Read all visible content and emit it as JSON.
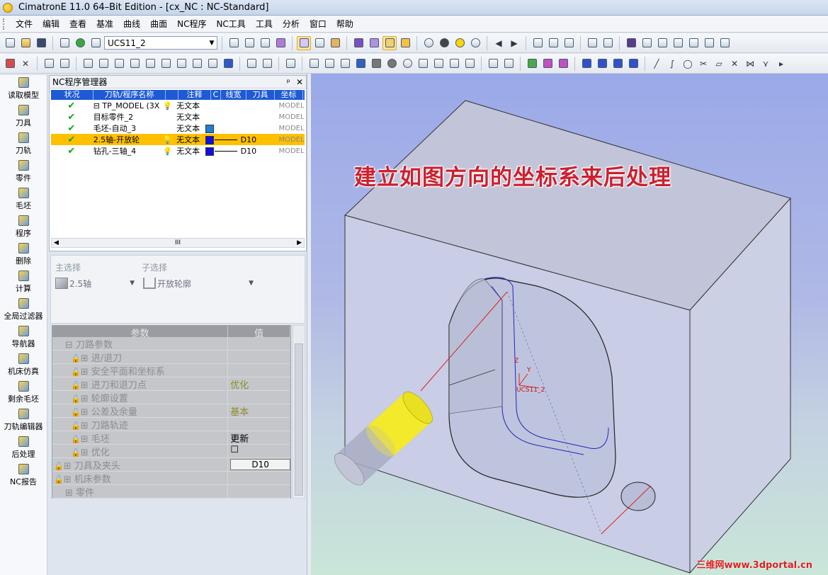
{
  "window": {
    "title": "CimatronE 11.0 64–Bit Edition - [cx_NC : NC-Standard]"
  },
  "menu": [
    "文件",
    "编辑",
    "查看",
    "基准",
    "曲线",
    "曲面",
    "NC程序",
    "NC工具",
    "工具",
    "分析",
    "窗口",
    "帮助"
  ],
  "toolbar": {
    "ucs_value": "UCS11_2"
  },
  "sidebar": [
    {
      "label": "读取模型",
      "icon": "load-model-icon"
    },
    {
      "label": "刀具",
      "icon": "tool-icon"
    },
    {
      "label": "刀轨",
      "icon": "toolpath-icon"
    },
    {
      "label": "零件",
      "icon": "part-icon"
    },
    {
      "label": "毛坯",
      "icon": "stock-icon"
    },
    {
      "label": "程序",
      "icon": "procedure-icon"
    },
    {
      "label": "删除",
      "icon": "delete-icon"
    },
    {
      "label": "计算",
      "icon": "calculate-icon"
    },
    {
      "label": "全局过滤器",
      "icon": "global-filter-icon"
    },
    {
      "label": "导航器",
      "icon": "navigator-icon"
    },
    {
      "label": "机床仿真",
      "icon": "machine-sim-icon"
    },
    {
      "label": "剩余毛坯",
      "icon": "remaining-stock-icon"
    },
    {
      "label": "刀轨编辑器",
      "icon": "toolpath-editor-icon"
    },
    {
      "label": "后处理",
      "icon": "post-process-icon"
    },
    {
      "label": "NC报告",
      "icon": "nc-report-icon"
    }
  ],
  "nc_manager": {
    "title": "NC程序管理器",
    "pin": "ᵖ",
    "close": "✕",
    "columns": [
      "状况",
      "刀轨/程序名称",
      "",
      "注释",
      "C",
      "线宽",
      "刀具",
      "坐标"
    ],
    "rows": [
      {
        "name": "TP_MODEL (3X",
        "comment": "无文本",
        "tool": "",
        "coord": "MODEL",
        "color": "",
        "bulb": true,
        "expand": "⊟"
      },
      {
        "name": "目标零件_2",
        "comment": "无文本",
        "tool": "",
        "coord": "MODEL",
        "color": "",
        "bulb": false,
        "expand": ""
      },
      {
        "name": "毛坯-自动_3",
        "comment": "无文本",
        "tool": "",
        "coord": "MODEL",
        "color": "#1d7fd6",
        "bulb": false,
        "expand": ""
      },
      {
        "name": "2.5轴-开放轮",
        "comment": "无文本",
        "tool": "D10",
        "coord": "MODEL",
        "color": "#1010e0",
        "bulb": true,
        "expand": "",
        "selected": true
      },
      {
        "name": "钻孔-三轴_4",
        "comment": "无文本",
        "tool": "D10",
        "coord": "MODEL",
        "color": "#1010e0",
        "bulb": true,
        "expand": ""
      }
    ],
    "scroll_mark": "III"
  },
  "selection": {
    "main_label": "主选择",
    "main_value": "2.5轴",
    "sub_label": "子选择",
    "sub_value": "开放轮廓"
  },
  "params": {
    "header_param": "参数",
    "header_value": "值",
    "rows": [
      {
        "label": "刀路参数",
        "prefix": "⊟",
        "indent": 18,
        "value": "",
        "vclass": ""
      },
      {
        "label": "进/退刀",
        "prefix": "⊞",
        "indent": 26,
        "lock": true,
        "value": "",
        "vclass": ""
      },
      {
        "label": "安全平面和坐标系",
        "prefix": "⊞",
        "indent": 26,
        "lock": true,
        "value": "",
        "vclass": ""
      },
      {
        "label": "进刀和退刀点",
        "prefix": "⊞",
        "indent": 26,
        "lock": true,
        "value": "优化",
        "vclass": "olive"
      },
      {
        "label": "轮廓设置",
        "prefix": "⊞",
        "indent": 26,
        "lock": true,
        "value": "",
        "vclass": ""
      },
      {
        "label": "公差及余量",
        "prefix": "⊞",
        "indent": 26,
        "lock": true,
        "value": "基本",
        "vclass": "olive"
      },
      {
        "label": "刀路轨迹",
        "prefix": "⊞",
        "indent": 26,
        "lock": true,
        "value": "",
        "vclass": ""
      },
      {
        "label": "毛坯",
        "prefix": "⊞",
        "indent": 26,
        "lock": true,
        "value": "更新",
        "vclass": "blk"
      },
      {
        "label": "优化",
        "prefix": "⊞",
        "indent": 26,
        "lock": true,
        "value": "☐",
        "vclass": "blk"
      },
      {
        "label": "刀具及夹头",
        "prefix": "⊞",
        "indent": 2,
        "lock": true,
        "value": "D10",
        "vclass": "btn"
      },
      {
        "label": "机床参数",
        "prefix": "⊞",
        "indent": 2,
        "lock": true,
        "value": "",
        "vclass": ""
      },
      {
        "label": "零件",
        "prefix": "⊞",
        "indent": 18,
        "value": "",
        "vclass": ""
      }
    ]
  },
  "viewport": {
    "annotation": "建立如图方向的坐标系来后处理",
    "axis_z": "Z",
    "axis_y": "Y",
    "ucs_label": "UCS11_2",
    "watermark": "三维网www.3dportal.cn"
  }
}
